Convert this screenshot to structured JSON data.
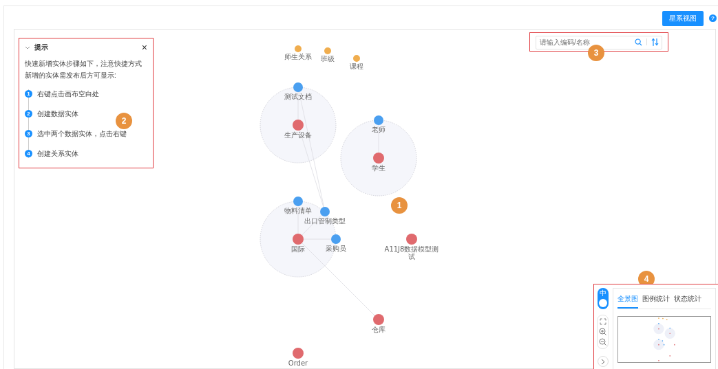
{
  "toolbar": {
    "view_button": "星系视图",
    "help": "?"
  },
  "tips": {
    "title": "提示",
    "close": "×",
    "description": "快速新增实体步骤如下，注意快捷方式新增的实体需发布后方可显示:",
    "expanded": true,
    "steps": [
      {
        "number": "1",
        "text": "右键点击画布空白处"
      },
      {
        "number": "2",
        "text": "创建数据实体"
      },
      {
        "number": "3",
        "text": "选中两个数据实体，点击右键"
      },
      {
        "number": "4",
        "text": "创建关系实体"
      }
    ]
  },
  "search": {
    "placeholder": "请输入编码/名称"
  },
  "graph": {
    "nodes": [
      {
        "label": "师生关系",
        "color": "#f0ad4e"
      },
      {
        "label": "班级",
        "color": "#f0ad4e"
      },
      {
        "label": "课程",
        "color": "#f0ad4e"
      },
      {
        "label": "测试文档",
        "color": "#4a9ff0"
      },
      {
        "label": "生产设备",
        "color": "#e06a6e"
      },
      {
        "label": "老师",
        "color": "#4a9ff0"
      },
      {
        "label": "学生",
        "color": "#e06a6e"
      },
      {
        "label": "物料清单",
        "color": "#4a9ff0"
      },
      {
        "label": "出口管制类型",
        "color": "#4a9ff0"
      },
      {
        "label": "国际",
        "color": "#e06a6e"
      },
      {
        "label": "采购员",
        "color": "#4a9ff0"
      },
      {
        "label": "A11J8数据模型测试",
        "color": "#e06a6e"
      },
      {
        "label": "仓库",
        "color": "#e06a6e"
      },
      {
        "label": "Order",
        "color": "#e06a6e"
      }
    ]
  },
  "callouts": [
    "1",
    "2",
    "3",
    "4"
  ],
  "controls": {
    "mode_toggle": {
      "label": "中",
      "on": true
    }
  },
  "overview": {
    "tabs": [
      {
        "label": "全景图",
        "selected": true
      },
      {
        "label": "图例统计",
        "selected": false
      },
      {
        "label": "状态统计",
        "selected": false
      }
    ]
  }
}
